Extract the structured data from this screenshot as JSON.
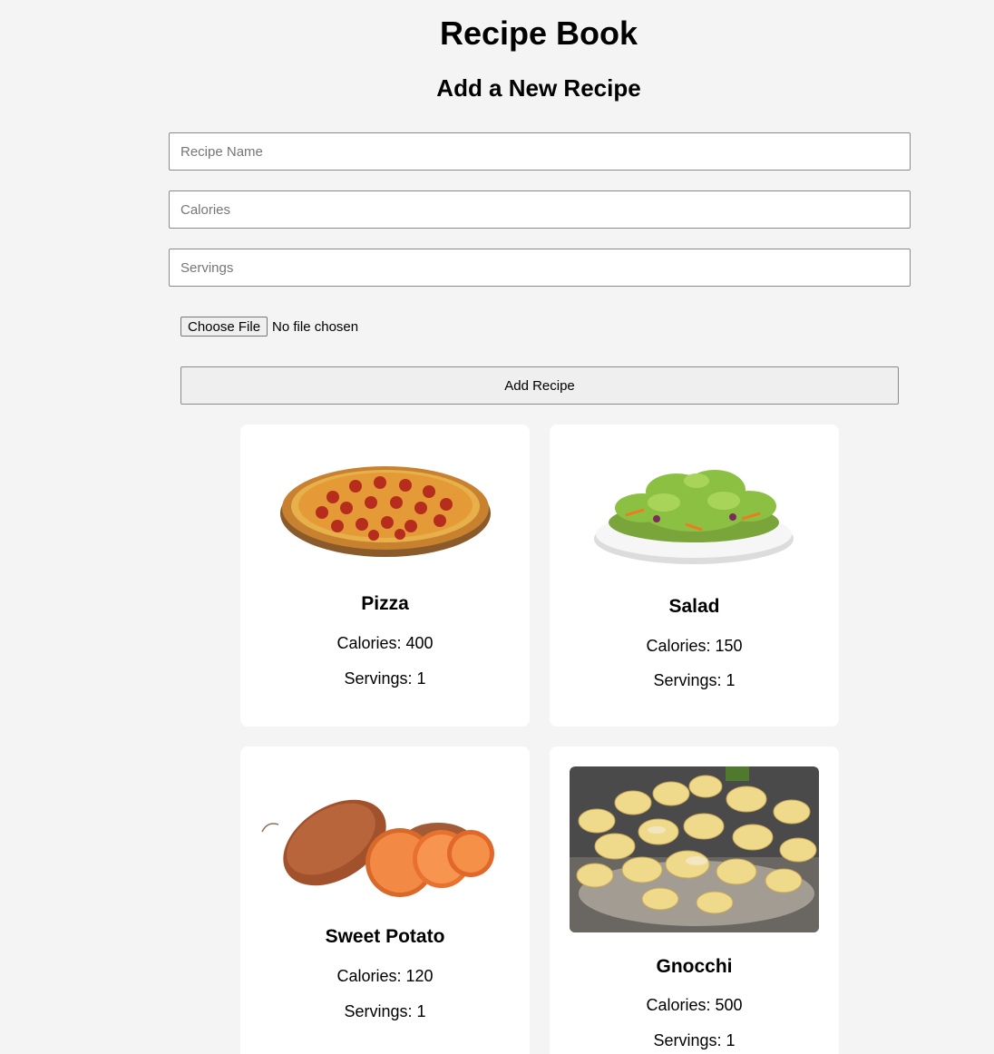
{
  "header": {
    "title": "Recipe Book",
    "subtitle": "Add a New Recipe"
  },
  "form": {
    "name_placeholder": "Recipe Name",
    "calories_placeholder": "Calories",
    "servings_placeholder": "Servings",
    "file_button_label": "Choose File",
    "file_status": "No file chosen",
    "submit_label": "Add Recipe"
  },
  "recipes": [
    {
      "name": "Pizza",
      "calories": "Calories: 400",
      "servings": "Servings: 1",
      "image": "pizza-photo"
    },
    {
      "name": "Salad",
      "calories": "Calories: 150",
      "servings": "Servings: 1",
      "image": "salad-photo"
    },
    {
      "name": "Sweet Potato",
      "calories": "Calories: 120",
      "servings": "Servings: 1",
      "image": "sweet-potato-photo"
    },
    {
      "name": "Gnocchi",
      "calories": "Calories: 500",
      "servings": "Servings: 1",
      "image": "gnocchi-photo"
    }
  ]
}
